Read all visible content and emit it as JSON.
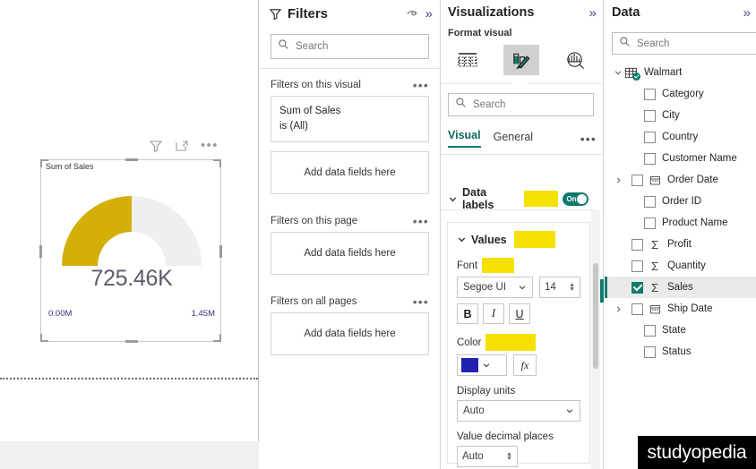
{
  "canvas": {
    "visual_header": {
      "filter_icon": "filter-icon",
      "focus_icon": "focus-mode-icon",
      "more_icon": "more-options-icon"
    },
    "gauge": {
      "title": "Sum of Sales",
      "value_label": "725.46K",
      "min_label": "0.00M",
      "max_label": "1.45M",
      "fill_color": "#d4af0a",
      "track_color": "#efefef",
      "value_color": "#5b5b6b",
      "percent": 50
    }
  },
  "filters": {
    "title": "Filters",
    "hide_icon": "eye-icon",
    "collapse_icon": "double-chevron-right-icon",
    "search": {
      "placeholder": "Search",
      "icon": "search-icon"
    },
    "sections": [
      {
        "label": "Filters on this visual",
        "menu_icon": "more-options-icon",
        "card": {
          "field": "Sum of Sales",
          "condition": "is (All)"
        },
        "dropzone": "Add data fields here"
      },
      {
        "label": "Filters on this page",
        "menu_icon": "more-options-icon",
        "dropzone": "Add data fields here"
      },
      {
        "label": "Filters on all pages",
        "menu_icon": "more-options-icon",
        "dropzone": "Add data fields here"
      }
    ]
  },
  "visualizations": {
    "title": "Visualizations",
    "collapse_icon": "double-chevron-right-icon",
    "format_visual_label": "Format visual",
    "format_tabs": [
      {
        "name": "build-visual-icon",
        "active": false
      },
      {
        "name": "format-paintbrush-icon",
        "active": true
      },
      {
        "name": "analytics-magnifier-icon",
        "active": false
      }
    ],
    "search": {
      "placeholder": "Search",
      "icon": "search-icon"
    },
    "tabs": [
      {
        "label": "Visual",
        "active": true
      },
      {
        "label": "General",
        "active": false
      }
    ],
    "tabs_menu_icon": "more-options-icon",
    "data_labels": {
      "label": "Data labels",
      "chevron_icon": "chevron-down-icon",
      "toggle_label": "On",
      "toggle_state": true,
      "toggle_color": "#0f7a6c",
      "highlight_color": "#f5e000"
    },
    "values": {
      "label": "Values",
      "chevron_icon": "chevron-down-icon",
      "font_label": "Font",
      "font_family": "Segoe UI",
      "font_size": "14",
      "bold_label": "B",
      "italic_label": "I",
      "underline_label": "U",
      "color_label": "Color",
      "color_value": "#2222b2",
      "fx_label": "fx",
      "display_units_label": "Display units",
      "display_units_value": "Auto",
      "decimal_places_label": "Value decimal places",
      "decimal_places_value": "Auto"
    }
  },
  "data": {
    "title": "Data",
    "collapse_icon": "double-chevron-right-icon",
    "search": {
      "placeholder": "Search",
      "icon": "search-icon"
    },
    "table": {
      "name": "Walmart",
      "icon": "table-icon",
      "expanded": true
    },
    "fields": [
      {
        "label": "Category",
        "icon": "none",
        "checked": false,
        "expandable": false
      },
      {
        "label": "City",
        "icon": "none",
        "checked": false,
        "expandable": false
      },
      {
        "label": "Country",
        "icon": "none",
        "checked": false,
        "expandable": false
      },
      {
        "label": "Customer Name",
        "icon": "none",
        "checked": false,
        "expandable": false
      },
      {
        "label": "Order Date",
        "icon": "calendar-icon",
        "checked": false,
        "expandable": true
      },
      {
        "label": "Order ID",
        "icon": "none",
        "checked": false,
        "expandable": false
      },
      {
        "label": "Product Name",
        "icon": "none",
        "checked": false,
        "expandable": false
      },
      {
        "label": "Profit",
        "icon": "sigma-icon",
        "checked": false,
        "expandable": false
      },
      {
        "label": "Quantity",
        "icon": "sigma-icon",
        "checked": false,
        "expandable": false
      },
      {
        "label": "Sales",
        "icon": "sigma-icon",
        "checked": true,
        "expandable": false
      },
      {
        "label": "Ship Date",
        "icon": "calendar-icon",
        "checked": false,
        "expandable": true
      },
      {
        "label": "State",
        "icon": "none",
        "checked": false,
        "expandable": false
      },
      {
        "label": "Status",
        "icon": "none",
        "checked": false,
        "expandable": false
      }
    ]
  },
  "watermark": {
    "text": "studyopedia"
  }
}
